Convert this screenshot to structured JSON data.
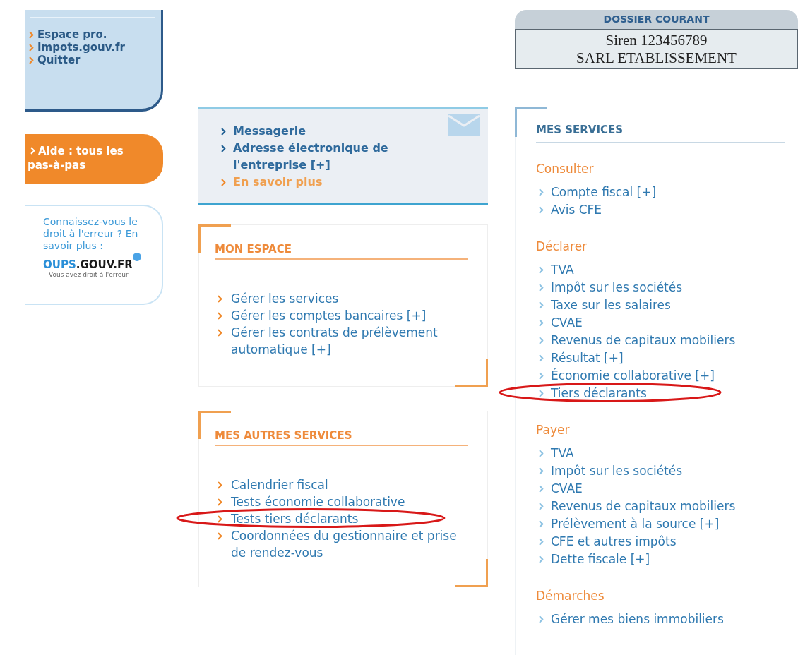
{
  "left_panel": {
    "links": [
      "Espace pro.",
      "Impots.gouv.fr",
      "Quitter"
    ]
  },
  "help_button": {
    "label": "Aide : tous les pas-à-pas"
  },
  "oups_card": {
    "text": "Connaissez-vous le droit à l'erreur ? En savoir plus :",
    "logo_main": "OUPS",
    "logo_rest": ".GOUV.FR",
    "tagline": "Vous avez droit à l'erreur"
  },
  "messagerie": {
    "links": [
      {
        "label": "Messagerie",
        "kind": "link"
      },
      {
        "label": "Adresse électronique de l'entreprise [+]",
        "kind": "link"
      },
      {
        "label": "En savoir plus",
        "kind": "more"
      }
    ]
  },
  "mon_espace": {
    "title": "MON ESPACE",
    "links": [
      "Gérer les services",
      "Gérer les comptes bancaires [+]",
      "Gérer les contrats de prélèvement automatique [+]"
    ]
  },
  "mes_autres_services": {
    "title": "MES AUTRES SERVICES",
    "links": [
      "Calendrier fiscal",
      "Tests économie collaborative",
      "Tests tiers déclarants",
      "Coordonnées du gestionnaire et prise de rendez-vous"
    ]
  },
  "dossier_courant": {
    "title": "DOSSIER COURANT",
    "siren": "Siren 123456789",
    "name": "SARL ETABLISSEMENT"
  },
  "mes_services": {
    "title": "MES SERVICES",
    "sections": [
      {
        "heading": "Consulter",
        "links": [
          "Compte fiscal [+]",
          "Avis CFE"
        ]
      },
      {
        "heading": "Déclarer",
        "links": [
          "TVA",
          "Impôt sur les sociétés",
          "Taxe sur les salaires",
          "CVAE",
          "Revenus de capitaux mobiliers",
          "Résultat [+]",
          "Économie collaborative [+]",
          "Tiers déclarants"
        ]
      },
      {
        "heading": "Payer",
        "links": [
          "TVA",
          "Impôt sur les sociétés",
          "CVAE",
          "Revenus de capitaux mobiliers",
          "Prélèvement à la source [+]",
          "CFE et autres impôts",
          "Dette fiscale [+]"
        ]
      },
      {
        "heading": "Démarches",
        "links": [
          "Gérer mes biens immobiliers"
        ]
      }
    ]
  }
}
